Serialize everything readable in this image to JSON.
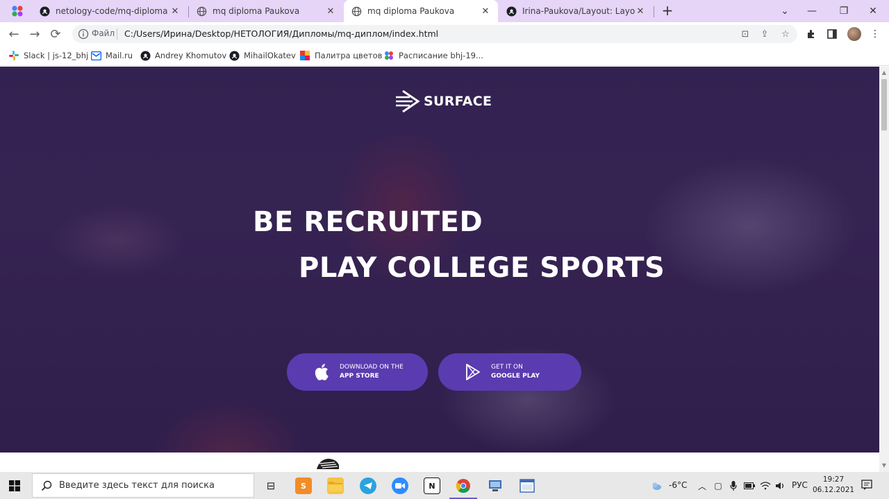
{
  "browser": {
    "tabs": [
      {
        "title": "netology-code/mq-diploma",
        "icon": "github-icon",
        "active": false
      },
      {
        "title": "mq diploma Paukova",
        "icon": "globe-icon",
        "active": false
      },
      {
        "title": "mq diploma Paukova",
        "icon": "globe-icon",
        "active": true
      },
      {
        "title": "Irina-Paukova/Layout: Layout wit",
        "icon": "github-icon",
        "active": false
      }
    ],
    "address": {
      "scheme_label": "Файл",
      "url": "C:/Users/Ирина/Desktop/НЕТОЛОГИЯ/Дипломы/mq-диплом/index.html"
    },
    "bookmarks": [
      {
        "label": "Slack | js-12_bhj",
        "icon": "slack-icon"
      },
      {
        "label": "Mail.ru",
        "icon": "mail-icon"
      },
      {
        "label": "Andrey Khomutov",
        "icon": "github-icon"
      },
      {
        "label": "MihailOkatev",
        "icon": "github-icon"
      },
      {
        "label": "Палитра цветов",
        "icon": "palette-icon"
      },
      {
        "label": "Расписание bhj-19...",
        "icon": "schedule-icon"
      }
    ]
  },
  "hero": {
    "logo_text": "SURFACE",
    "headline_1": "BE RECRUITED",
    "headline_2": "PLAY COLLEGE SPORTS",
    "app_store": {
      "line1": "DOWNLOAD ON THE",
      "line2": "APP STORE"
    },
    "google_play": {
      "line1": "GET IT ON",
      "line2": "GOOGLE PLAY"
    }
  },
  "taskbar": {
    "search_placeholder": "Введите здесь текст для поиска",
    "temperature": "-6°C",
    "language": "РУС",
    "time": "19:27",
    "date": "06.12.2021"
  },
  "colors": {
    "tab_strip": "#e6d5f7",
    "store_button": "#5b3bb0",
    "hero_overlay": "#2a1a4a"
  }
}
